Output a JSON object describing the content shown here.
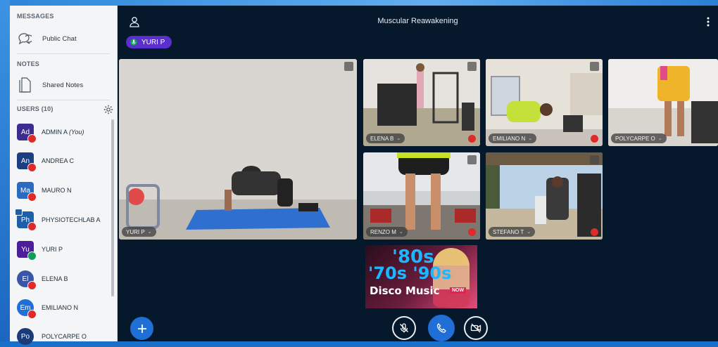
{
  "sidebar": {
    "messages_title": "MESSAGES",
    "public_chat": "Public Chat",
    "notes_title": "NOTES",
    "shared_notes": "Shared Notes",
    "users_title": "USERS (10)",
    "users": [
      {
        "initials": "Ad",
        "name": "ADMIN A",
        "suffix": "(You)",
        "color": "#3d2c8f",
        "shape": "square",
        "mic": "muted"
      },
      {
        "initials": "An",
        "name": "ANDREA C",
        "suffix": "",
        "color": "#1d3f82",
        "shape": "square",
        "mic": "muted"
      },
      {
        "initials": "Ma",
        "name": "MAURO N",
        "suffix": "",
        "color": "#2a6bbf",
        "shape": "square",
        "mic": "muted"
      },
      {
        "initials": "Ph",
        "name": "PHYSIOTECHLAB A",
        "suffix": "",
        "color": "#1f5fa8",
        "shape": "square",
        "mic": "muted"
      },
      {
        "initials": "Yu",
        "name": "YURI P",
        "suffix": "",
        "color": "#4b1e9a",
        "shape": "square",
        "mic": "on"
      },
      {
        "initials": "El",
        "name": "ELENA B",
        "suffix": "",
        "color": "#3a55a8",
        "shape": "round",
        "mic": "muted"
      },
      {
        "initials": "Em",
        "name": "EMILIANO N",
        "suffix": "",
        "color": "#1f6fd6",
        "shape": "round",
        "mic": "muted"
      },
      {
        "initials": "Po",
        "name": "POLYCARPE O",
        "suffix": "",
        "color": "#1c3a78",
        "shape": "round",
        "mic": "muted"
      }
    ]
  },
  "header": {
    "title": "Muscular Reawakening",
    "talking_user": "YURI P"
  },
  "tiles": [
    {
      "name": "YURI P"
    },
    {
      "name": "ELENA B"
    },
    {
      "name": "EMILIANO N"
    },
    {
      "name": "POLYCARPE O"
    },
    {
      "name": "RENZO M"
    },
    {
      "name": "STEFANO T"
    }
  ],
  "screenshare": {
    "line1": "'80s",
    "line2": "'70s '90s",
    "line3": "Disco Music",
    "badge": "NOW"
  },
  "colors": {
    "accent": "#1f6fd6",
    "talking": "#5b2fcf",
    "muted": "#df2a2a",
    "unmuted": "#0f9d58",
    "main_bg": "#06182b"
  }
}
